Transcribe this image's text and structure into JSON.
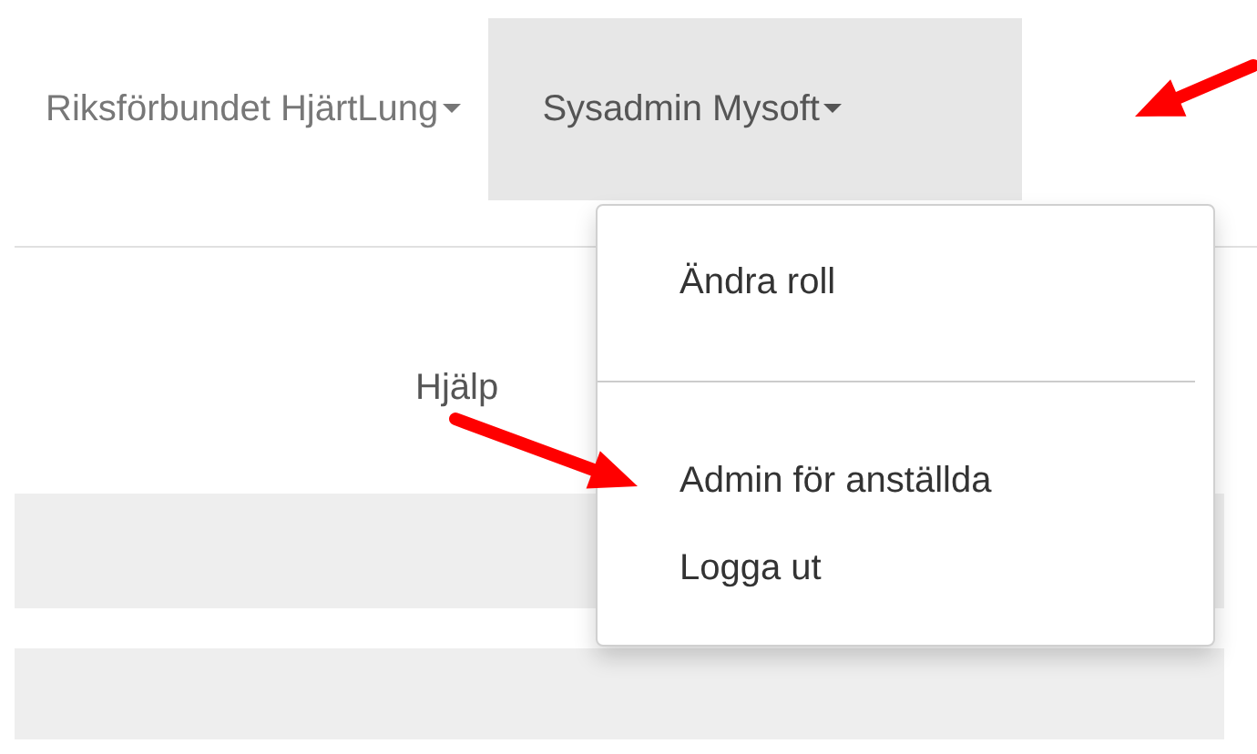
{
  "navbar": {
    "items": [
      {
        "label": "Riksförbundet HjärtLung",
        "open": false
      },
      {
        "label": "Sysadmin Mysoft",
        "open": true
      }
    ]
  },
  "dropdown": {
    "sections": [
      [
        {
          "label": "Ändra roll"
        }
      ],
      [
        {
          "label": "Admin för anställda"
        },
        {
          "label": "Logga ut"
        }
      ]
    ]
  },
  "links": [
    {
      "label": "Hjälp"
    }
  ]
}
